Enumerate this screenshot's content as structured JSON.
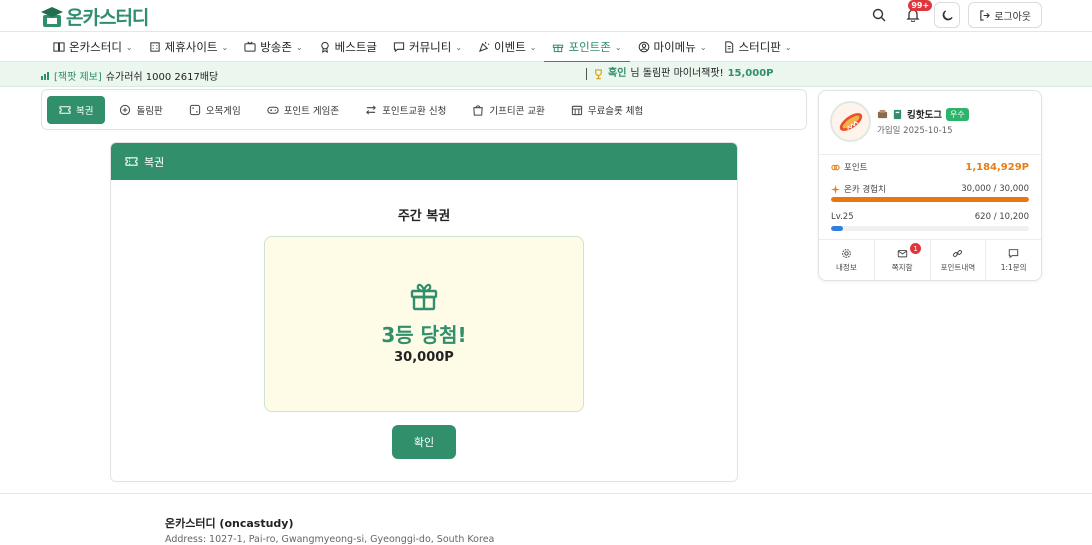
{
  "brand": {
    "logo_text": "온카스터디",
    "accent": "#318f6c"
  },
  "topbar": {
    "bell_badge": "99+",
    "logout_label": "로그아웃"
  },
  "nav": [
    {
      "label": "온카스터디",
      "icon": "book-icon",
      "dropdown": true,
      "active": false
    },
    {
      "label": "제휴사이트",
      "icon": "building-icon",
      "dropdown": true,
      "active": false
    },
    {
      "label": "방송존",
      "icon": "tv-icon",
      "dropdown": true,
      "active": false
    },
    {
      "label": "베스트글",
      "icon": "award-icon",
      "dropdown": false,
      "active": false
    },
    {
      "label": "커뮤니티",
      "icon": "chat-icon",
      "dropdown": true,
      "active": false
    },
    {
      "label": "이벤트",
      "icon": "party-icon",
      "dropdown": true,
      "active": false
    },
    {
      "label": "포인트존",
      "icon": "gift-icon",
      "dropdown": true,
      "active": true
    },
    {
      "label": "마이메뉴",
      "icon": "user-icon",
      "dropdown": true,
      "active": false
    },
    {
      "label": "스터디판",
      "icon": "document-icon",
      "dropdown": true,
      "active": false
    }
  ],
  "ticker": {
    "left_tag": "[잭팟 제보]",
    "left_text": "슈가러쉬 1000 2617배당",
    "right_user": "혹인",
    "right_mid": "님 돌림판 마이너잭팟!",
    "right_amount": "15,000P"
  },
  "subtabs": [
    {
      "label": "복권",
      "icon": "ticket-icon",
      "active": true
    },
    {
      "label": "돌림판",
      "icon": "wheel-icon",
      "active": false
    },
    {
      "label": "오목게임",
      "icon": "dice-icon",
      "active": false
    },
    {
      "label": "포인트 게임존",
      "icon": "gamepad-icon",
      "active": false
    },
    {
      "label": "포인트교환 신청",
      "icon": "exchange-icon",
      "active": false
    },
    {
      "label": "기프티콘 교환",
      "icon": "bag-icon",
      "active": false
    },
    {
      "label": "무료슬롯 체험",
      "icon": "slot-icon",
      "active": false
    }
  ],
  "lottery": {
    "header": "복권",
    "title": "주간 복권",
    "result": "3등 당첨!",
    "amount": "30,000P",
    "confirm_label": "확인"
  },
  "profile": {
    "name": "킹핫도그",
    "grade_badge": "우수",
    "join_date": "가입일 2025-10-15",
    "points_label": "포인트",
    "points_value": "1,184,929P",
    "exp_label": "온카 경험치",
    "exp_value": "30,000 / 30,000",
    "exp_fraction": 1.0,
    "level_label": "Lv.25",
    "level_value": "620 / 10,200",
    "level_fraction": 0.061,
    "menu": [
      {
        "label": "내정보",
        "icon": "gear-icon"
      },
      {
        "label": "쪽지함",
        "icon": "mail-icon",
        "badge": "1"
      },
      {
        "label": "포인트내역",
        "icon": "link-icon"
      },
      {
        "label": "1:1문의",
        "icon": "message-icon"
      }
    ]
  },
  "footer": {
    "company": "온카스터디 (oncastudy)",
    "address": "Address: 1027-1, Pai-ro, Gwangmyeong-si, Gyeonggi-do, South Korea"
  }
}
